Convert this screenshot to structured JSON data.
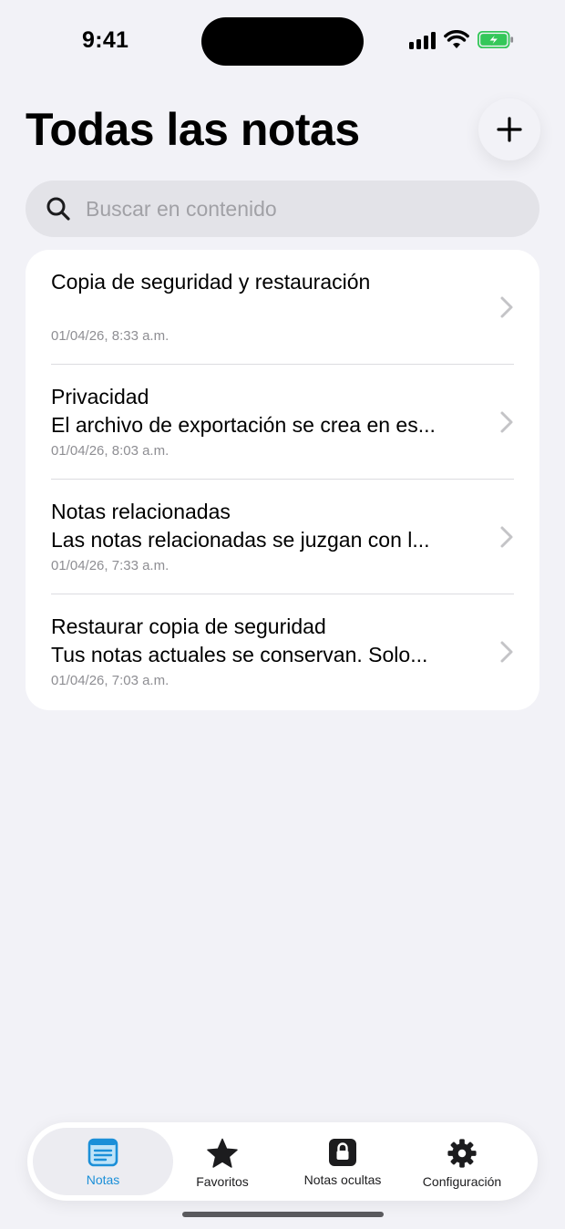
{
  "status_bar": {
    "time": "9:41"
  },
  "header": {
    "title": "Todas las notas",
    "add_icon": "plus-icon"
  },
  "search": {
    "placeholder": "Buscar en contenido",
    "value": "",
    "icon": "search-icon"
  },
  "notes": [
    {
      "title": "Copia de seguridad y restauración",
      "snippet": "",
      "date": "01/04/26, 8:33 a.m."
    },
    {
      "title": "Privacidad",
      "snippet": "El archivo de exportación se crea en es...",
      "date": "01/04/26, 8:03 a.m."
    },
    {
      "title": "Notas relacionadas",
      "snippet": "Las notas relacionadas se juzgan con l...",
      "date": "01/04/26, 7:33 a.m."
    },
    {
      "title": "Restaurar copia de seguridad",
      "snippet": "Tus notas actuales se conservan. Solo...",
      "date": "01/04/26, 7:03 a.m."
    }
  ],
  "tab_bar": {
    "tabs": [
      {
        "label": "Notas",
        "icon": "notes-icon",
        "active": true
      },
      {
        "label": "Favoritos",
        "icon": "star-icon",
        "active": false
      },
      {
        "label": "Notas ocultas",
        "icon": "lock-icon",
        "active": false
      },
      {
        "label": "Configuración",
        "icon": "gear-icon",
        "active": false
      }
    ]
  },
  "colors": {
    "accent": "#1b8fd8",
    "background": "#f2f2f7",
    "battery": "#34c759"
  }
}
